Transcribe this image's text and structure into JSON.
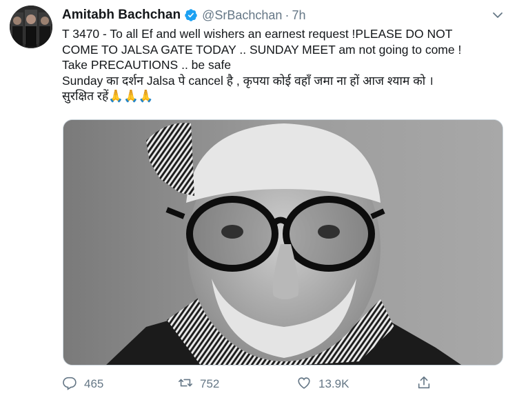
{
  "author": {
    "display_name": "Amitabh Bachchan",
    "handle": "@SrBachchan",
    "separator": "·",
    "time": "7h",
    "verified": true
  },
  "tweet": {
    "lines": [
      "T 3470 - To all Ef and well wishers an earnest request !PLEASE DO NOT",
      "COME TO JALSA GATE TODAY .. SUNDAY MEET am not going to come !",
      "Take PRECAUTIONS  .. be safe",
      "Sunday का दर्शन Jalsa पे cancel है , कृपया कोई वहाँ जमा ना हों आज श्याम को  ।",
      "सुरक्षित रहें🙏🙏🙏"
    ]
  },
  "media": {
    "description_icon": "photo"
  },
  "actions": {
    "reply_count": "465",
    "retweet_count": "752",
    "like_count": "13.9K"
  },
  "colors": {
    "text": "#14171a",
    "secondary": "#657786",
    "verified": "#1da1f2",
    "border": "#ccd6dd"
  }
}
